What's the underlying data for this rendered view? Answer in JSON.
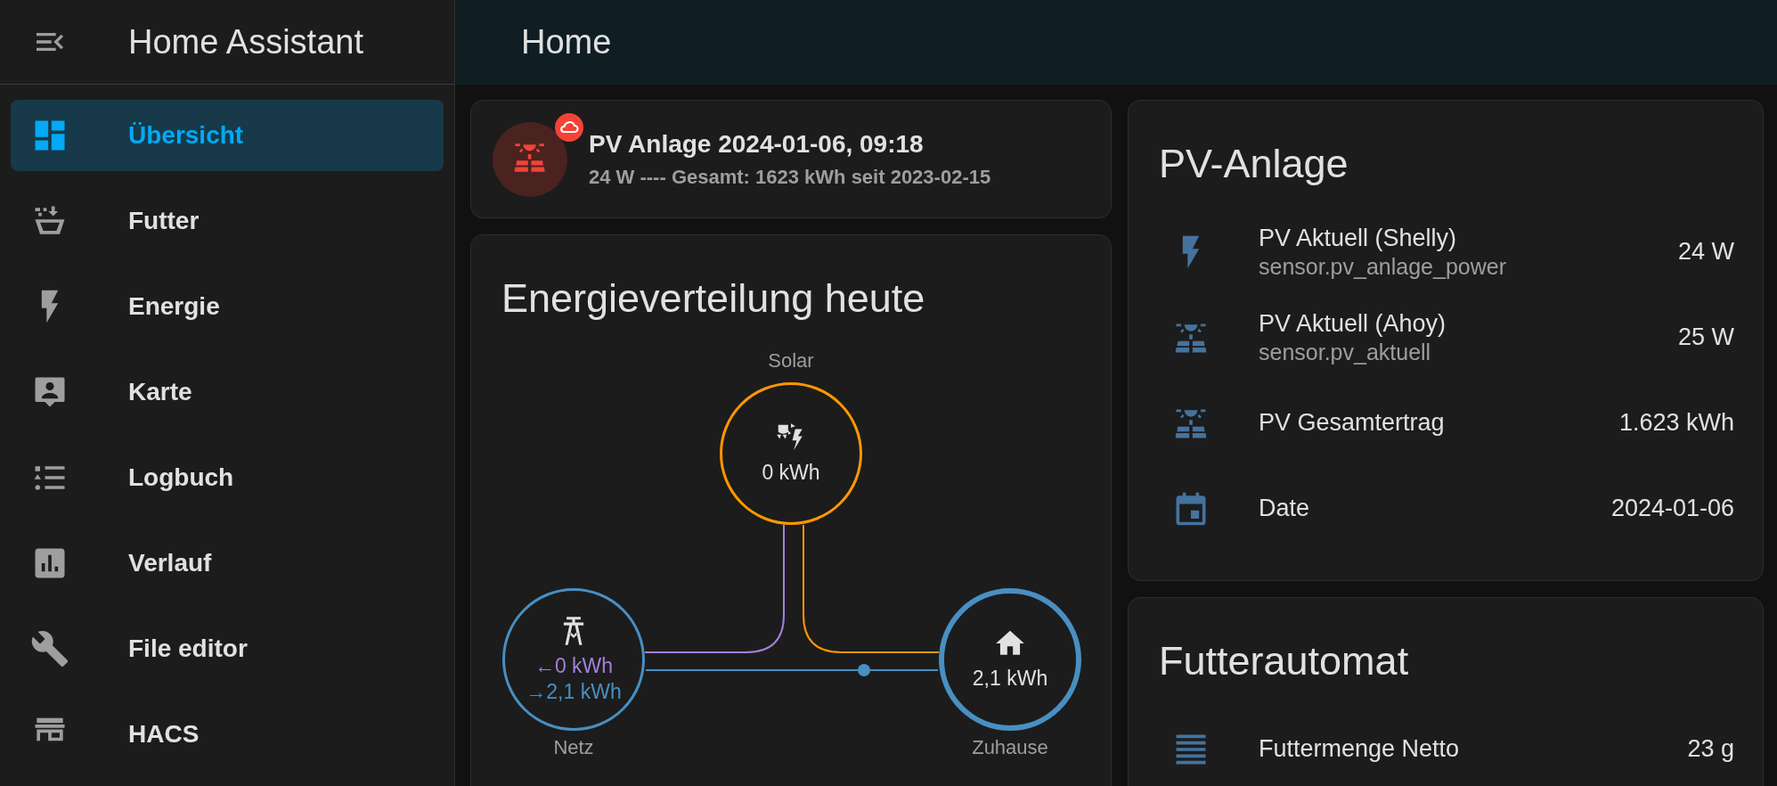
{
  "sidebar": {
    "title": "Home Assistant",
    "items": [
      {
        "label": "Übersicht",
        "selected": true,
        "kind": "dashboard"
      },
      {
        "label": "Futter",
        "selected": false,
        "kind": "feeder"
      },
      {
        "label": "Energie",
        "selected": false,
        "kind": "energy"
      },
      {
        "label": "Karte",
        "selected": false,
        "kind": "map"
      },
      {
        "label": "Logbuch",
        "selected": false,
        "kind": "logbook"
      },
      {
        "label": "Verlauf",
        "selected": false,
        "kind": "history"
      },
      {
        "label": "File editor",
        "selected": false,
        "kind": "editor"
      },
      {
        "label": "HACS",
        "selected": false,
        "kind": "store"
      }
    ]
  },
  "header": {
    "title": "Home"
  },
  "status_card": {
    "title": "PV Anlage 2024-01-06, 09:18",
    "subtitle": "24 W ---- Gesamt: 1623 kWh seit 2023-02-15"
  },
  "energy_card": {
    "title": "Energieverteilung heute",
    "nodes": [
      {
        "kind": "solar",
        "label": "Solar",
        "color": "#ff9800",
        "values": [
          {
            "text": "0 kWh",
            "color": "#e1e1e1"
          }
        ]
      },
      {
        "kind": "grid",
        "label": "Netz",
        "color": "#488fc2",
        "values": [
          {
            "text": "←0 kWh",
            "color": "#a280db"
          },
          {
            "text": "→2,1 kWh",
            "color": "#488fc2"
          }
        ]
      },
      {
        "kind": "home",
        "label": "Zuhause",
        "color": "#488fc2",
        "values": [
          {
            "text": "2,1 kWh",
            "color": "#e1e1e1"
          }
        ]
      }
    ],
    "flows": [
      {
        "kind": "solar-grid",
        "color": "#a280db"
      },
      {
        "kind": "solar-home",
        "color": "#ff9800"
      },
      {
        "kind": "grid-home",
        "color": "#488fc2"
      }
    ]
  },
  "cards": [
    {
      "title": "PV-Anlage",
      "entities": [
        {
          "kind": "power",
          "name": "PV Aktuell (Shelly)",
          "entity_id": "sensor.pv_anlage_power",
          "state": "24 W"
        },
        {
          "kind": "solar",
          "name": "PV Aktuell (Ahoy)",
          "entity_id": "sensor.pv_aktuell",
          "state": "25 W"
        },
        {
          "kind": "solar",
          "name": "PV Gesamtertrag",
          "state": "1.623 kWh"
        },
        {
          "kind": "date",
          "name": "Date",
          "state": "2024-01-06"
        }
      ]
    },
    {
      "title": "Futterautomat",
      "entities": [
        {
          "kind": "weight",
          "name": "Futtermenge Netto",
          "state": "23 g"
        }
      ]
    }
  ]
}
